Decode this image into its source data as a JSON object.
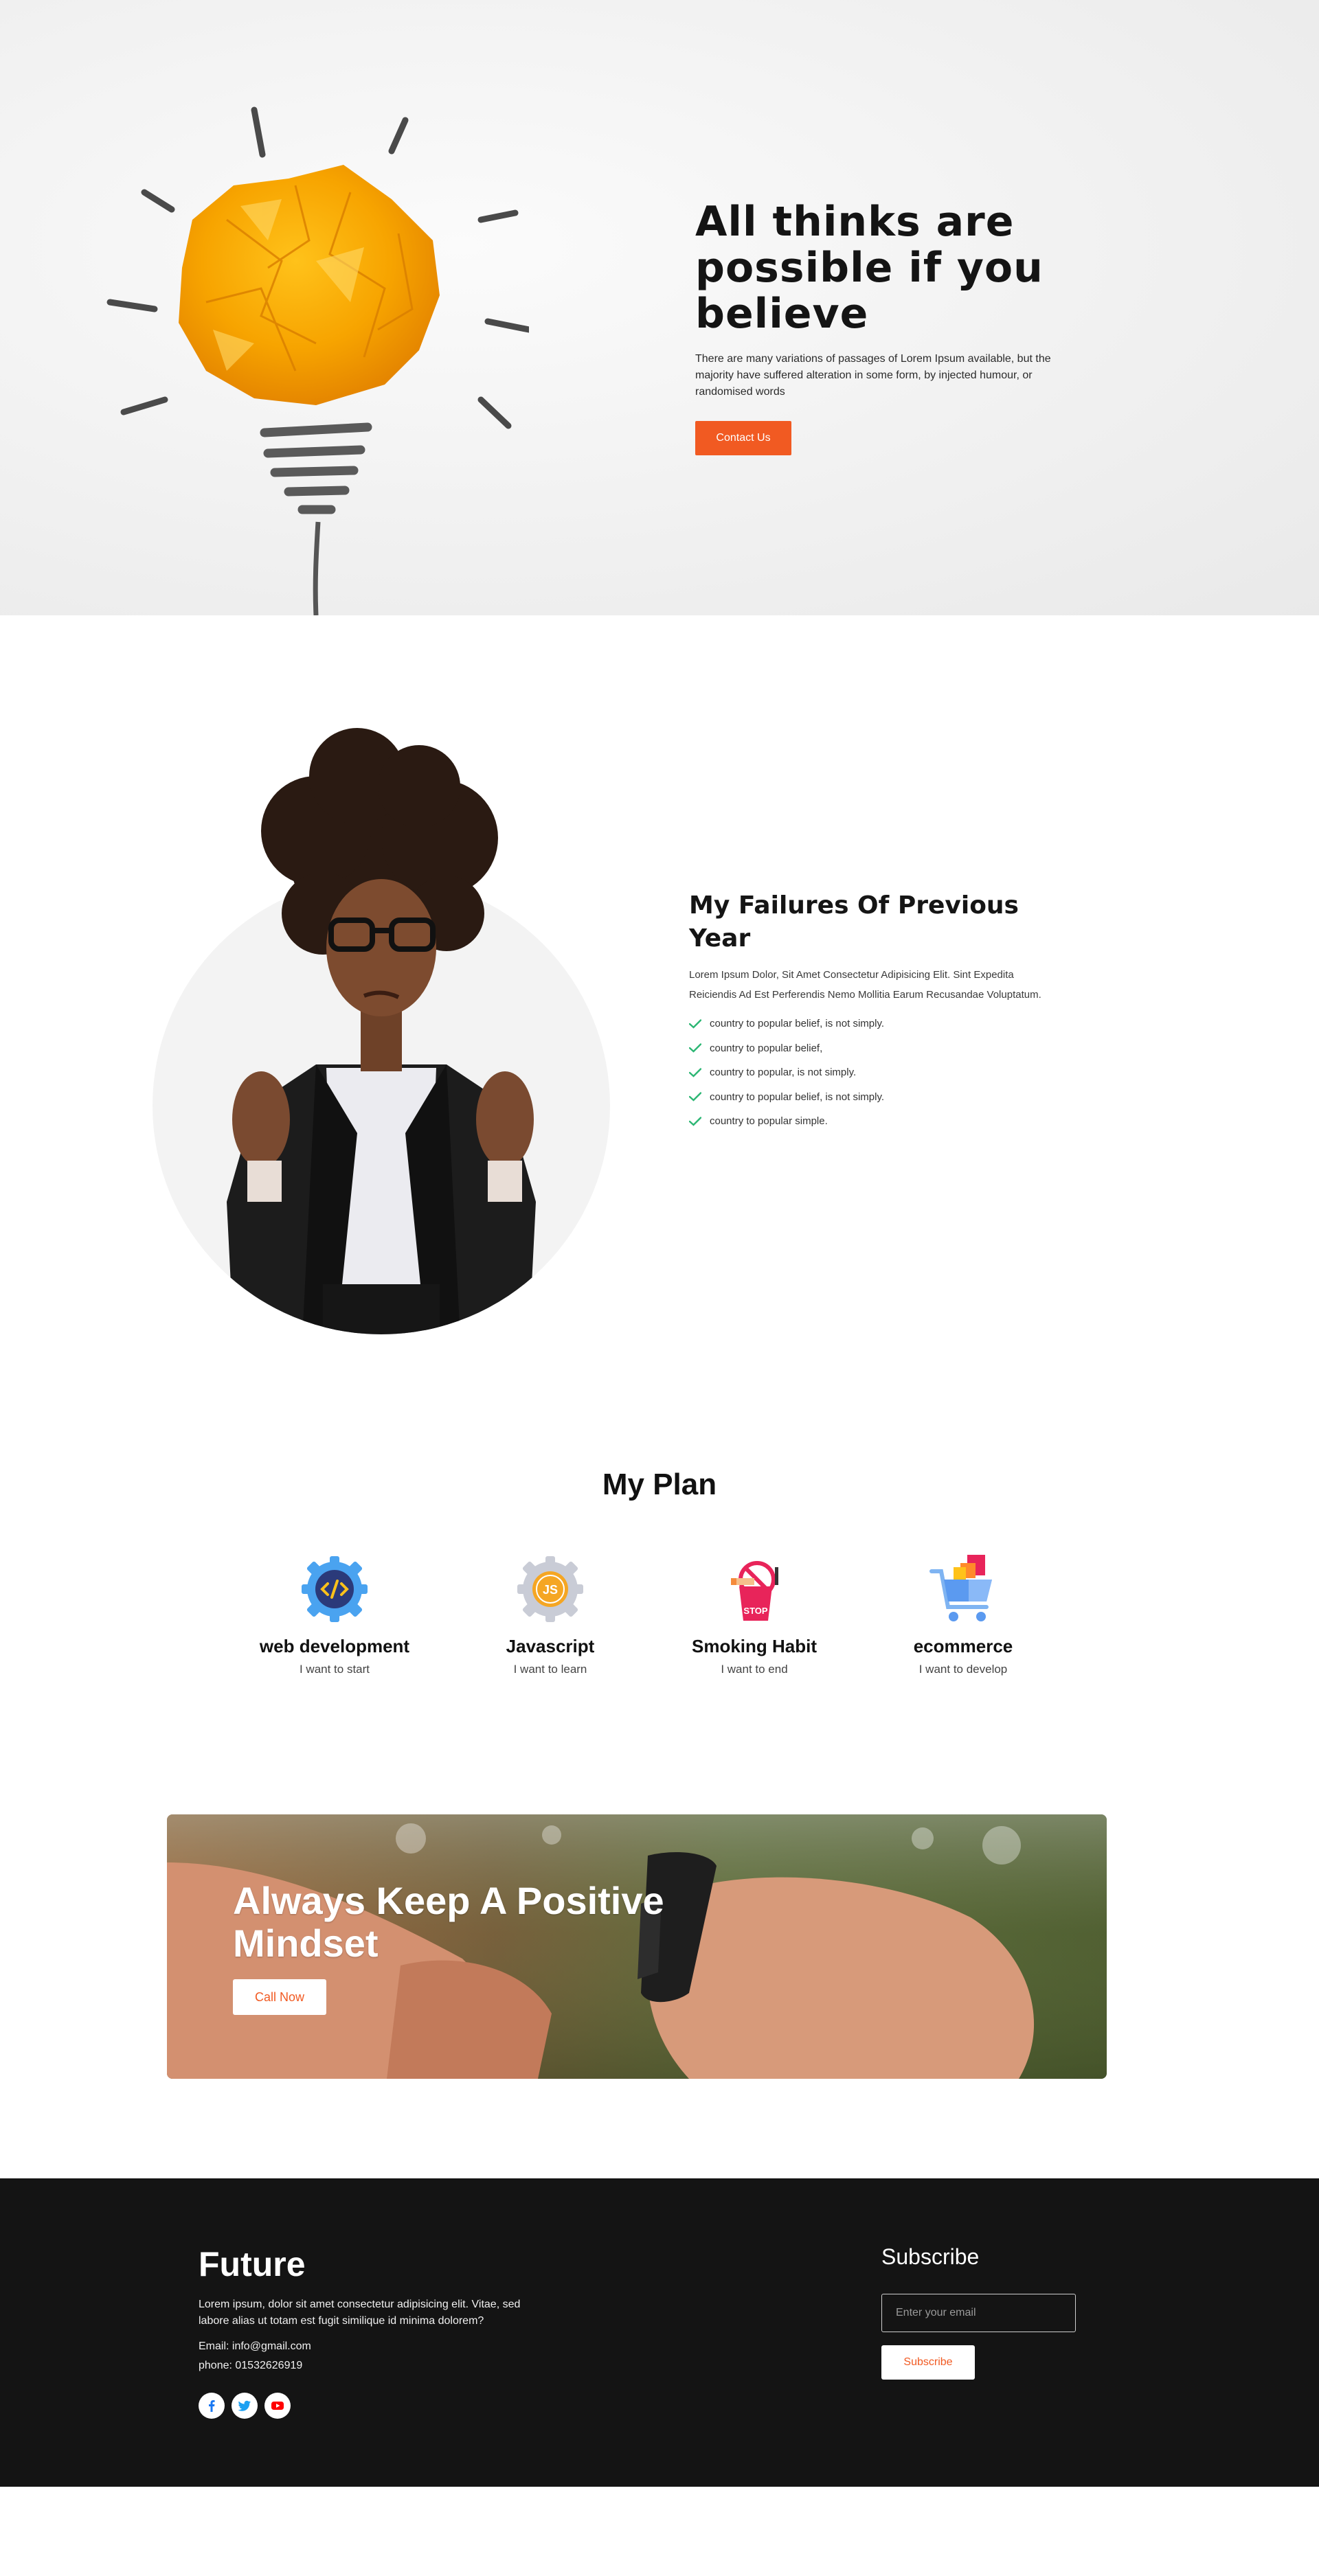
{
  "hero": {
    "title": "All thinks are possible if you believe",
    "description": "There are many variations of passages of Lorem Ipsum available, but the majority have suffered alteration in some form, by injected humour, or randomised words",
    "button_label": "Contact Us"
  },
  "failures": {
    "title": "My Failures Of Previous Year",
    "description": "Lorem Ipsum Dolor, Sit Amet Consectetur Adipisicing Elit. Sint Expedita Reiciendis Ad Est Perferendis Nemo Mollitia Earum Recusandae Voluptatum.",
    "items": [
      "country to popular belief, is not simply.",
      "country to popular belief,",
      "country to popular, is not simply.",
      "country to popular belief, is not simply.",
      "country to popular simple."
    ]
  },
  "plan": {
    "title": "My Plan",
    "items": [
      {
        "name": "web development",
        "subtitle": "I want to start",
        "icon": "gear-code-icon"
      },
      {
        "name": "Javascript",
        "subtitle": "I want to learn",
        "icon": "gear-js-icon"
      },
      {
        "name": "Smoking Habit",
        "subtitle": "I want to end",
        "icon": "stop-smoking-icon"
      },
      {
        "name": "ecommerce",
        "subtitle": "I want to develop",
        "icon": "shopping-cart-icon"
      }
    ],
    "icon_label_js": "JS",
    "icon_label_stop": "STOP"
  },
  "banner": {
    "title": "Always Keep A Positive Mindset",
    "button_label": "Call Now"
  },
  "footer": {
    "brand": "Future",
    "description": "Lorem ipsum, dolor sit amet consectetur adipisicing elit. Vitae, sed labore alias ut totam est fugit similique id minima dolorem?",
    "email": "Email: info@gmail.com",
    "phone": "phone: 01532626919",
    "socials": [
      "facebook-icon",
      "twitter-icon",
      "youtube-icon"
    ],
    "subscribe_title": "Subscribe",
    "subscribe_placeholder": "Enter your email",
    "subscribe_button": "Subscribe"
  },
  "colors": {
    "accent": "#f15a22",
    "footer_bg": "#141414",
    "check": "#2bb673"
  }
}
